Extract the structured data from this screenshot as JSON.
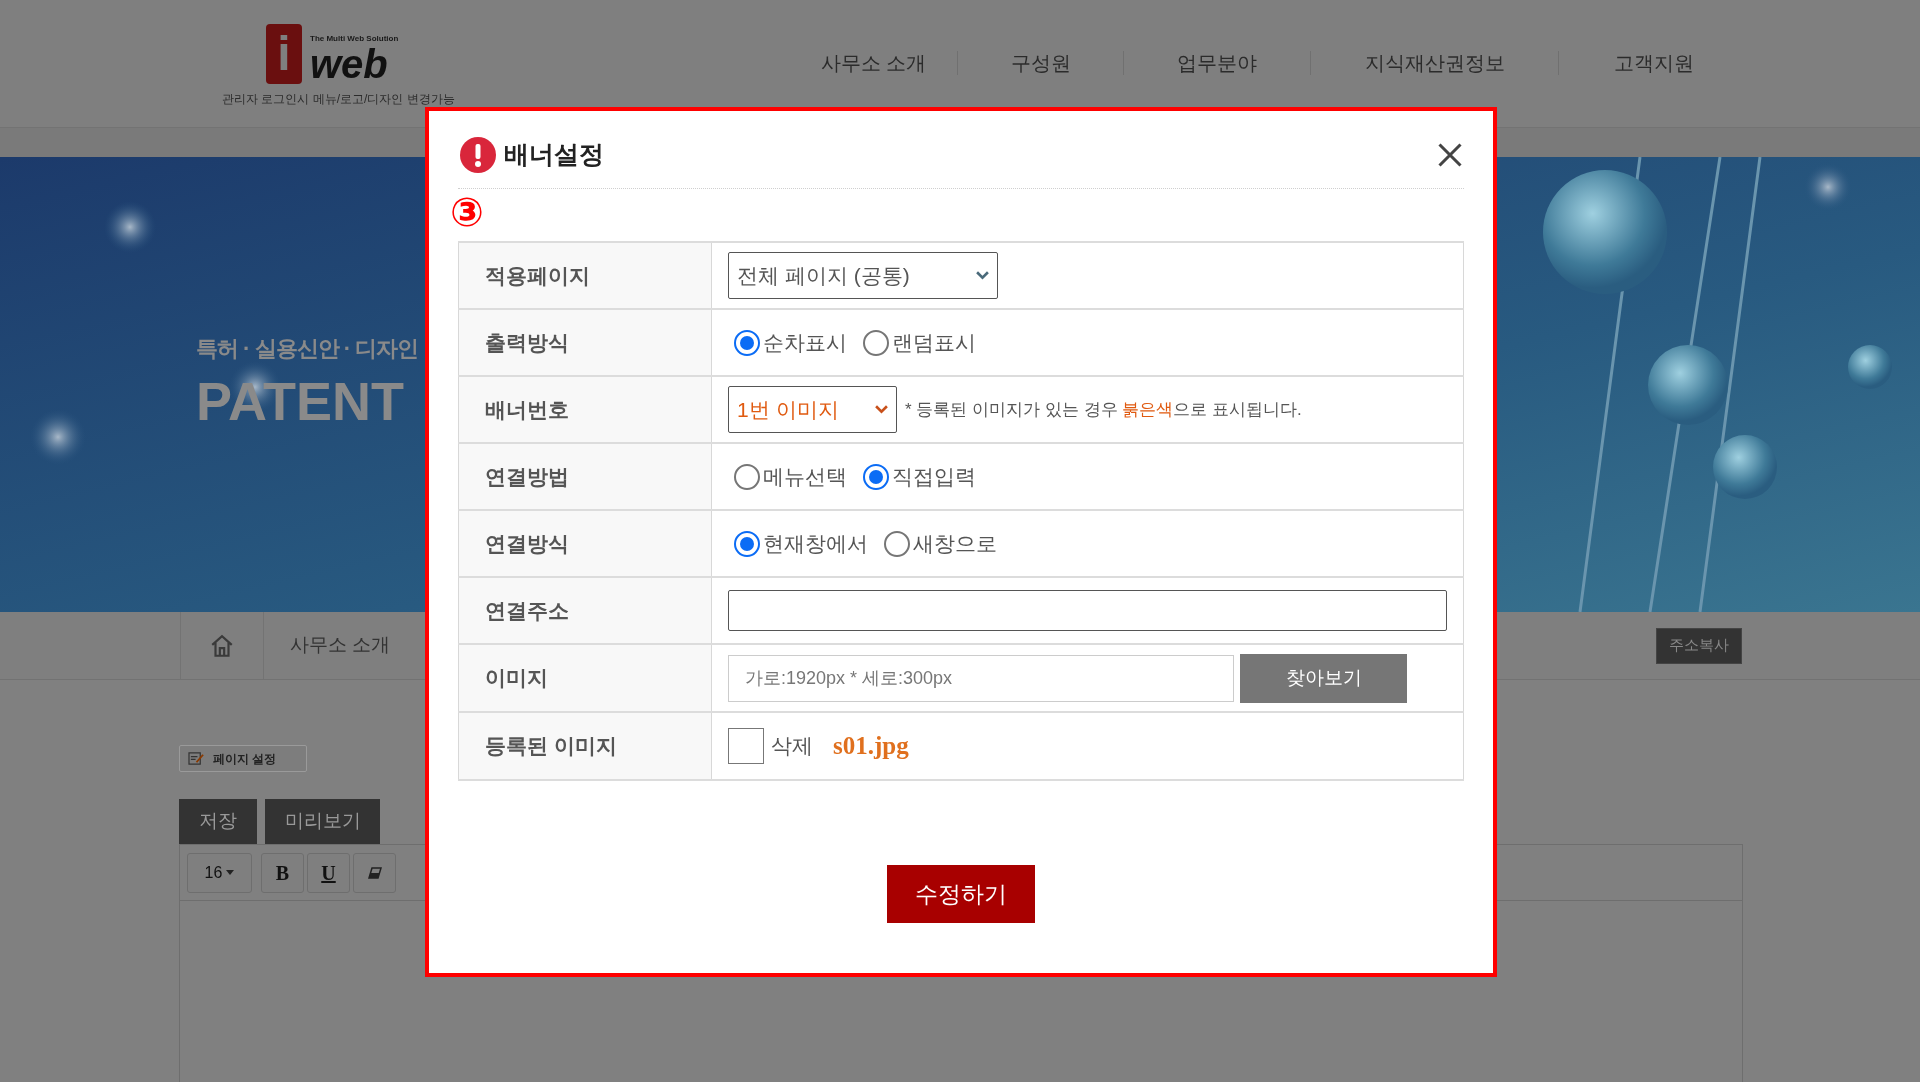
{
  "header": {
    "logo": {
      "letter": "i",
      "tagline": "The Multi Web Solution",
      "wordmark": "web"
    },
    "logo_caption": "관리자 로그인시 메뉴/로고/디자인 변경가능",
    "nav": [
      "사무소 소개",
      "구성원",
      "업무분야",
      "지식재산권정보",
      "고객지원"
    ]
  },
  "banner": {
    "kind": "picture",
    "subtitle": "특허 · 실용신안 · 디자인",
    "headline": "PATENT"
  },
  "breadcrumb": {
    "item": "사무소 소개",
    "copy_button": "주소복사"
  },
  "editor": {
    "page_settings": "페이지 설정",
    "buttons": [
      "저장",
      "미리보기"
    ],
    "toolbar": [
      {
        "kind": "dropdown",
        "label": "16"
      },
      {
        "kind": "bold",
        "label": "B"
      },
      {
        "kind": "underline",
        "label": "U"
      },
      {
        "kind": "eraser"
      }
    ]
  },
  "dialog": {
    "title": "배너설정",
    "step": "③",
    "rows": [
      {
        "kind": "select",
        "label": "적용페이지",
        "value": "전체 페이지 (공통)",
        "highlight": false
      },
      {
        "kind": "radio",
        "label": "출력방식",
        "options": [
          {
            "label": "순차표시",
            "selected": true
          },
          {
            "label": "랜덤표시",
            "selected": false
          }
        ]
      },
      {
        "kind": "select",
        "label": "배너번호",
        "value": "1번 이미지",
        "highlight": true,
        "note": "* 등록된 이미지가 있는 경우 ",
        "note_highlight": "붉은색",
        "note_end": "으로 표시됩니다."
      },
      {
        "kind": "radio",
        "label": "연결방법",
        "options": [
          {
            "label": "메뉴선택",
            "selected": false
          },
          {
            "label": "직접입력",
            "selected": true
          }
        ]
      },
      {
        "kind": "radio",
        "label": "연결방식",
        "options": [
          {
            "label": "현재창에서",
            "selected": true
          },
          {
            "label": "새창으로",
            "selected": false
          }
        ]
      },
      {
        "kind": "text",
        "label": "연결주소"
      },
      {
        "kind": "file",
        "label": "이미지",
        "placeholder": "가로:1920px * 세로:300px",
        "button": "찾아보기"
      },
      {
        "kind": "checkbox",
        "label": "등록된 이미지",
        "checkbox_label": "삭제",
        "checked": false,
        "file": "s01.jpg"
      }
    ],
    "submit": "수정하기"
  }
}
